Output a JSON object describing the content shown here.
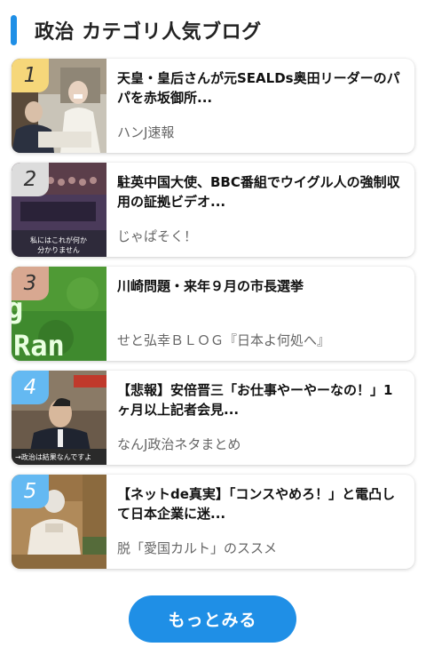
{
  "header": {
    "title": "政治 カテゴリ人気ブログ"
  },
  "items": [
    {
      "rank": "1",
      "title": "天皇・皇后さんが元SEALDs奥田リーダーのパパを赤坂御所...",
      "source": "ハンJ速報"
    },
    {
      "rank": "2",
      "title": "駐英中国大使、BBC番組でウイグル人の強制収用の証拠ビデオ...",
      "source": "じゃぱそく！",
      "thumb_caption": "私にはこれが何か分かりません"
    },
    {
      "rank": "3",
      "title": "川崎問題・来年９月の市長選挙",
      "source": "せと弘幸ＢＬＯＧ『日本よ何処へ』",
      "thumb_caption": "g Ran"
    },
    {
      "rank": "4",
      "title": "【悲報】安倍晋三「お仕事やーやーなの！」1ヶ月以上記者会見...",
      "source": "なんJ政治ネタまとめ",
      "thumb_caption": "→政治は結果なんですよ"
    },
    {
      "rank": "5",
      "title": "【ネットde真実】「コンスやめろ！」と電凸して日本企業に迷...",
      "source": "脱「愛国カルト」のススメ"
    }
  ],
  "more_button": {
    "label": "もっとみる"
  },
  "colors": {
    "accent": "#1f8fe6",
    "rank_gold": "#f6d77a",
    "rank_silver": "#dcdcdc",
    "rank_bronze": "#d8a891",
    "rank_blue": "#64b9f2"
  }
}
